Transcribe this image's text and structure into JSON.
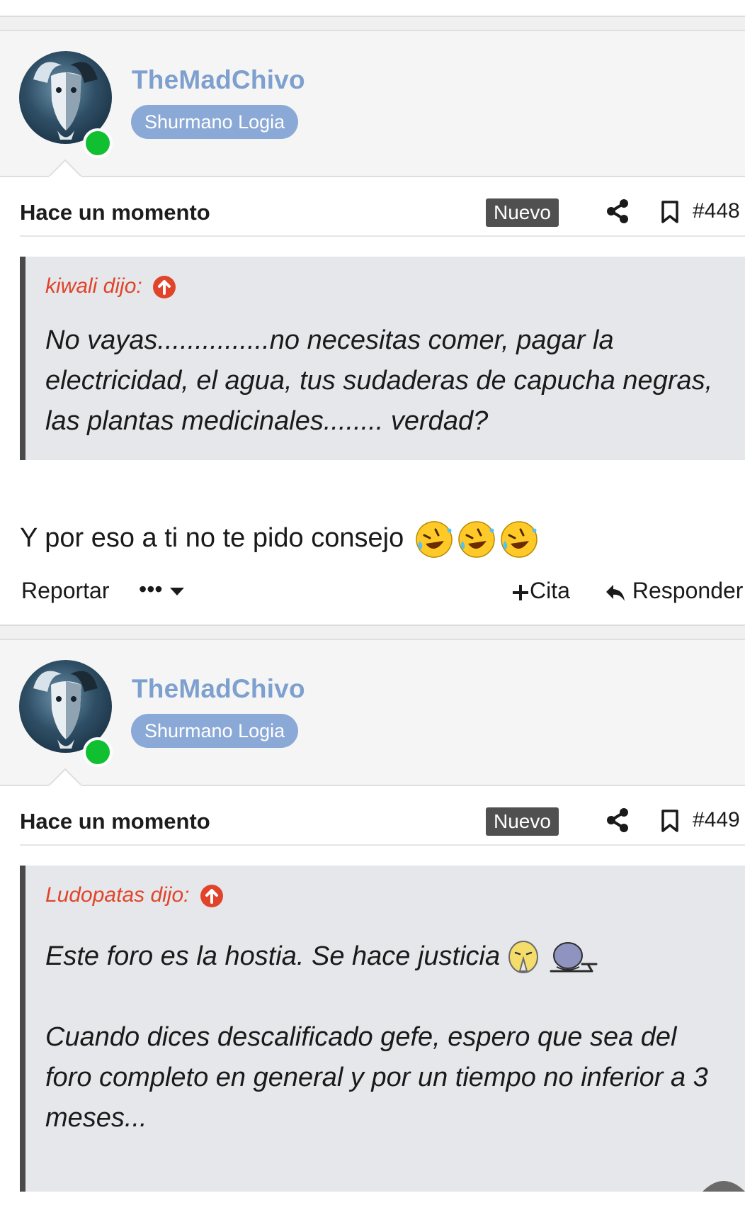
{
  "posts": [
    {
      "username": "TheMadChivo",
      "role": "Shurmano Logia",
      "time": "Hace un momento",
      "badge": "Nuevo",
      "number": "#448",
      "quote": {
        "author": "kiwali dijo:",
        "paragraphs": [
          "No vayas...............no necesitas comer, pagar la electricidad, el agua, tus sudaderas de capucha negras, las plantas medicinales........ verdad?"
        ]
      },
      "message": "Y por eso a ti no te pido consejo",
      "message_emojis": [
        "rofl-emoji",
        "rofl-emoji",
        "rofl-emoji"
      ],
      "actions": {
        "report": "Reportar",
        "more": "•••",
        "cite": "Cita",
        "reply": "Responder"
      }
    },
    {
      "username": "TheMadChivo",
      "role": "Shurmano Logia",
      "time": "Hace un momento",
      "badge": "Nuevo",
      "number": "#449",
      "quote": {
        "author": "Ludopatas dijo:",
        "paragraphs": [
          "Este foro es la hostia. Se hace justicia",
          "Cuando dices descalificado gefe, espero que sea del foro completo en general y por un tiempo no inferior a 3 meses..."
        ]
      }
    }
  ],
  "colors": {
    "username": "#7ea0cf",
    "role_badge_bg": "#8ba9d6",
    "online": "#10c030",
    "quote_author": "#e0452b",
    "new_badge_bg": "#505050"
  }
}
